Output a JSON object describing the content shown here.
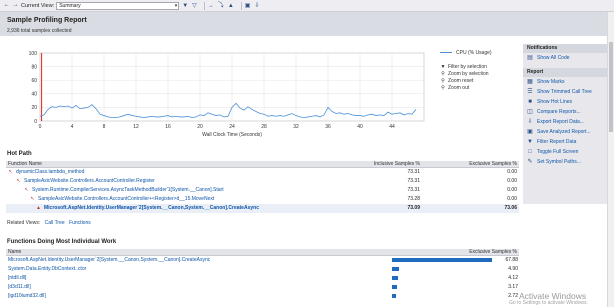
{
  "toolbar": {
    "back_icon": "back-arrow-icon",
    "forward_icon": "forward-arrow-icon",
    "current_view_label": "Current View:",
    "current_view_value": "Summary"
  },
  "header": {
    "title": "Sample Profiling Report",
    "subtitle": "2,936 total samples collected"
  },
  "chart_data": {
    "type": "line",
    "title": "",
    "xlabel": "Wall Clock Time (Seconds)",
    "ylabel": "",
    "xlim": [
      0,
      48
    ],
    "ylim": [
      0,
      100
    ],
    "xticks": [
      "0",
      "4",
      "8",
      "12",
      "16",
      "20",
      "24",
      "28",
      "32",
      "36",
      "40",
      "44"
    ],
    "yticks": [
      "0",
      "20",
      "40",
      "60",
      "80",
      "100"
    ],
    "grid": true,
    "legend_position": "right",
    "series": [
      {
        "name": "CPU (% Usage)",
        "color": "#4a90d9",
        "x": [
          0,
          0.5,
          1,
          1.5,
          2,
          2.5,
          3,
          3.5,
          4,
          4.5,
          5,
          5.5,
          6,
          6.5,
          7,
          7.5,
          8,
          8.5,
          9,
          9.5,
          10,
          10.5,
          11,
          11.5,
          12,
          12.5,
          13,
          13.5,
          14,
          14.5,
          15,
          15.5,
          16,
          16.5,
          17,
          17.5,
          18,
          18.5,
          19,
          19.5,
          20,
          20.5,
          21,
          21.5,
          22,
          22.5,
          23,
          23.5,
          24,
          24.5,
          25,
          25.5,
          26,
          26.5,
          27,
          27.5,
          28,
          28.5,
          29,
          29.5,
          30,
          30.5,
          31,
          31.5,
          32,
          32.5,
          33,
          33.5,
          34,
          34.5,
          35,
          35.5,
          36,
          36.5,
          37,
          37.5,
          38,
          38.5,
          39,
          39.5,
          40,
          40.5,
          41,
          41.5,
          42,
          42.5,
          43,
          43.5,
          44,
          44.5,
          45,
          45.5,
          46,
          46.5,
          47
        ],
        "values": [
          7,
          9,
          17,
          21,
          20,
          22,
          21,
          22,
          19,
          23,
          18,
          19,
          20,
          24,
          18,
          10,
          8,
          6,
          5,
          5,
          6,
          8,
          10,
          8,
          7,
          6,
          5,
          6,
          7,
          6,
          6,
          7,
          8,
          6,
          7,
          6,
          6,
          7,
          5,
          6,
          9,
          8,
          12,
          10,
          8,
          9,
          6,
          7,
          20,
          26,
          19,
          16,
          21,
          17,
          14,
          11,
          10,
          7,
          8,
          7,
          8,
          7,
          9,
          11,
          8,
          6,
          5,
          6,
          7,
          8,
          6,
          9,
          20,
          14,
          11,
          12,
          10,
          11,
          9,
          8,
          8,
          7,
          9,
          10,
          8,
          9,
          8,
          13,
          10,
          11,
          12,
          9,
          11,
          10,
          17
        ]
      }
    ],
    "markers": [
      {
        "type": "vertical-line",
        "x": 0.2,
        "color": "#e0271b"
      }
    ]
  },
  "chart_legend": {
    "series_label": "CPU (% Usage)",
    "filter_by_selection": "Filter by selection",
    "zoom_by_selection": "Zoom by selection",
    "zoom_reset": "Zoom reset",
    "zoom_out": "Zoom out"
  },
  "notifications": {
    "title": "Notifications",
    "items": [
      {
        "label": "Show All Code",
        "icon": "code-icon"
      }
    ]
  },
  "report": {
    "title": "Report",
    "items": [
      {
        "label": "Show Marks",
        "icon": "marks-icon"
      },
      {
        "label": "Show Trimmed Call Tree",
        "icon": "tree-icon"
      },
      {
        "label": "Show Hot Lines",
        "icon": "hot-lines-icon"
      },
      {
        "label": "Compare Reports...",
        "icon": "compare-icon"
      },
      {
        "label": "Export Report Data...",
        "icon": "export-icon"
      },
      {
        "label": "Save Analyzed Report...",
        "icon": "save-icon"
      },
      {
        "label": "Filter Report Data",
        "icon": "filter-icon"
      },
      {
        "label": "Toggle Full Screen",
        "icon": "fullscreen-icon"
      },
      {
        "label": "Set Symbol Paths...",
        "icon": "symbol-paths-icon"
      }
    ]
  },
  "hot_path": {
    "title": "Hot Path",
    "columns": [
      "Function Name",
      "Inclusive Samples %",
      "Exclusive Samples %"
    ],
    "rows": [
      {
        "name": "dynamicClass.lambda_method",
        "inclusive": "73.31",
        "exclusive": "0.00",
        "indent": 0
      },
      {
        "name": "SampleAsicWebsite.Controllers.AccountController.Register",
        "inclusive": "73.31",
        "exclusive": "0.00",
        "indent": 1
      },
      {
        "name": "System.Runtime.CompilerServices.AsyncTaskMethodBuilder'1[System.__Canon].Start",
        "inclusive": "73.31",
        "exclusive": "0.00",
        "indent": 2
      },
      {
        "name": "SampleAsicWebsite.Controllers.AccountController+<Register>d__15.MoveNext",
        "inclusive": "73.28",
        "exclusive": "0.00",
        "indent": 3
      },
      {
        "name": "Microsoft.AspNet.Identity.UserManager`2[System.__Canon,System.__Canon].CreateAsync",
        "inclusive": "73.09",
        "exclusive": "73.06",
        "indent": 4,
        "bold": true
      }
    ],
    "related_views_label": "Related Views:",
    "related_links": [
      "Call Tree",
      "Functions"
    ]
  },
  "functions_work": {
    "title": "Functions Doing Most Individual Work",
    "columns": [
      "Name",
      "Exclusive Samples %"
    ],
    "rows": [
      {
        "name": "Microsoft.AspNet.Identity.UserManager`2[System.__Canon,System.__Canon].CreateAsync",
        "value": 67.88,
        "label": "67.88"
      },
      {
        "name": "System.Data.Entity.DbContext..ctor",
        "value": 4.9,
        "label": "4.90"
      },
      {
        "name": "[ntdll.dll]",
        "value": 4.12,
        "label": "4.12"
      },
      {
        "name": "[d3d11.dll]",
        "value": 3.17,
        "label": "3.17"
      },
      {
        "name": "[igd10iumd32.dll]",
        "value": 2.72,
        "label": "2.72"
      }
    ]
  },
  "watermark": {
    "title": "Activate Windows",
    "sub": "Go to Settings to activate Windows."
  }
}
